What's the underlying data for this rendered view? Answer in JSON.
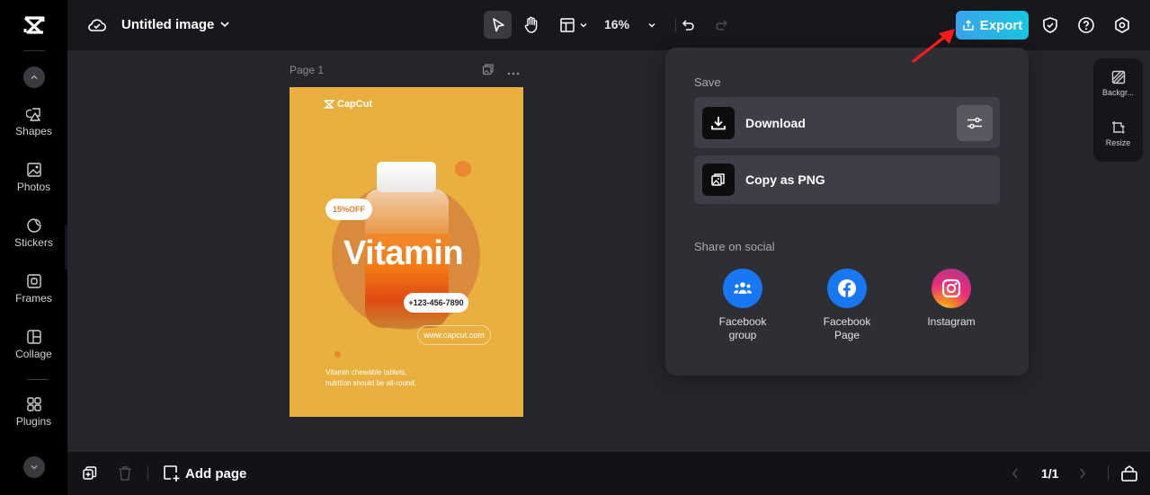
{
  "topbar": {
    "title": "Untitled image",
    "zoom": "16%",
    "export_label": "Export"
  },
  "sidebar": {
    "items": [
      {
        "label": "Shapes",
        "icon": "shapes-icon"
      },
      {
        "label": "Photos",
        "icon": "photo-icon"
      },
      {
        "label": "Stickers",
        "icon": "sticker-icon"
      },
      {
        "label": "Frames",
        "icon": "frame-icon"
      },
      {
        "label": "Collage",
        "icon": "collage-icon"
      },
      {
        "label": "Plugins",
        "icon": "plugins-icon"
      }
    ]
  },
  "canvas": {
    "page_label": "Page 1",
    "poster": {
      "brand": "CapCut",
      "discount": "15%OFF",
      "headline": "Vitamin",
      "phone": "+123-456-7890",
      "website": "www.capcut.com",
      "desc_line1": "Vitamin chewable tablets,",
      "desc_line2": "nutrition should be all-round.",
      "bg_color": "#eab03f"
    }
  },
  "export_panel": {
    "save_heading": "Save",
    "download_label": "Download",
    "copy_label": "Copy as PNG",
    "share_heading": "Share on social",
    "social": [
      {
        "label_line1": "Facebook",
        "label_line2": "group",
        "color": "#1877f2"
      },
      {
        "label_line1": "Facebook",
        "label_line2": "Page",
        "color": "#1877f2"
      },
      {
        "label_line1": "Instagram",
        "label_line2": ""
      }
    ]
  },
  "right_panel": {
    "background_label": "Backgr...",
    "resize_label": "Resize"
  },
  "bottombar": {
    "add_page_label": "Add page",
    "pager": "1/1"
  },
  "colors": {
    "accent_export_start": "#3aa4ec",
    "accent_export_end": "#19c6e0",
    "annotation_arrow": "#ff1a1a"
  }
}
